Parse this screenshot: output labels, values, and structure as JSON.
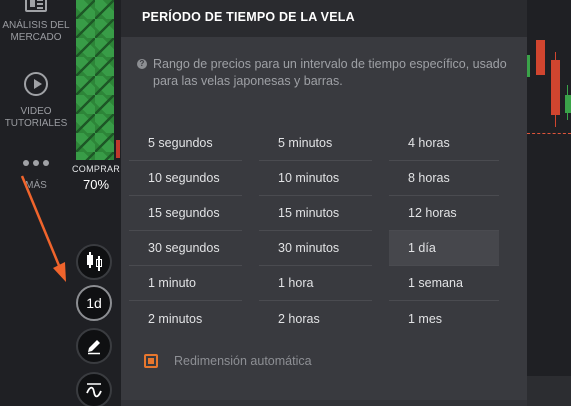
{
  "sidebar": {
    "analysis_line1": "ANÁLISIS DEL",
    "analysis_line2": "MERCADO",
    "video_line1": "VIDEO",
    "video_line2": "TUTORIALES",
    "more": "MÁS"
  },
  "trade": {
    "buy_label": "COMPRAR",
    "buy_percent": "70%"
  },
  "tools": {
    "period_label": "1d"
  },
  "panel": {
    "title": "PERÍODO DE TIEMPO DE LA VELA",
    "help_glyph": "?",
    "description": "Rango de precios para un intervalo de tiempo específico, usado para las velas japonesas y barras.",
    "options": [
      [
        "5 segundos",
        "5 minutos",
        "4 horas"
      ],
      [
        "10 segundos",
        "10 minutos",
        "8 horas"
      ],
      [
        "15 segundos",
        "15 minutos",
        "12 horas"
      ],
      [
        "30 segundos",
        "30 minutos",
        "1 día"
      ],
      [
        "1 minuto",
        "1 hora",
        "1 semana"
      ],
      [
        "2 minutos",
        "2 horas",
        "1 mes"
      ]
    ],
    "selected": "1 día",
    "auto_resize_label": "Redimensión automática",
    "auto_resize_checked": true
  },
  "colors": {
    "accent": "#e8772e",
    "candle_up": "#3aa349",
    "candle_down": "#d0452f"
  }
}
